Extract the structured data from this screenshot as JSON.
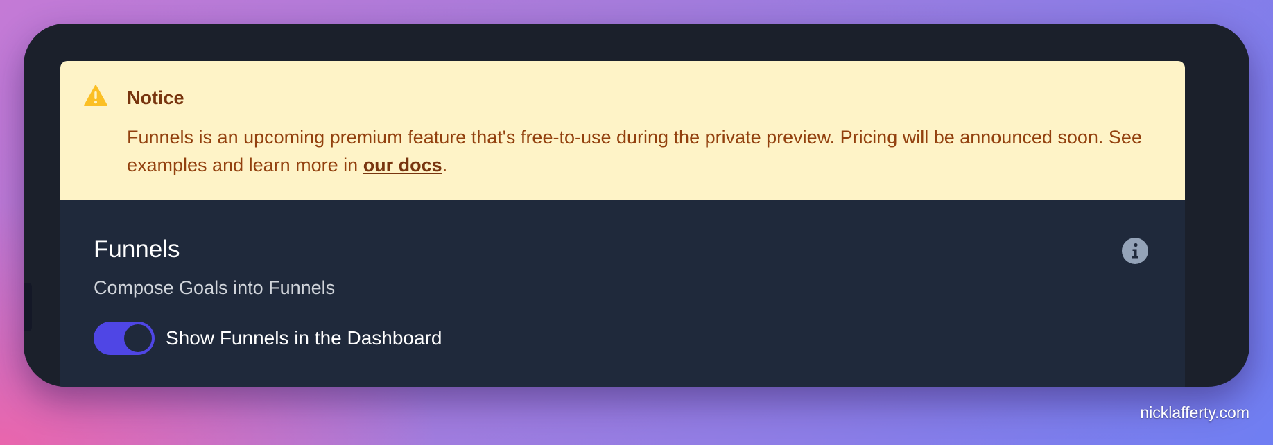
{
  "notice": {
    "icon": "warning-triangle-icon",
    "title": "Notice",
    "body_before_link": "Funnels is an upcoming premium feature that's free-to-use during the private preview. Pricing will be announced soon. See examples and learn more in ",
    "link_text": "our docs",
    "body_after_link": ".",
    "colors": {
      "background": "#fef3c7",
      "title": "#78350f",
      "text": "#92400e",
      "icon": "#fbbf24"
    }
  },
  "funnels": {
    "title": "Funnels",
    "subtitle": "Compose Goals into Funnels",
    "info_icon": "info-circle-icon",
    "toggle": {
      "label": "Show Funnels in the Dashboard",
      "checked": true,
      "color": "#4f46e5"
    }
  },
  "watermark": "nicklafferty.com"
}
